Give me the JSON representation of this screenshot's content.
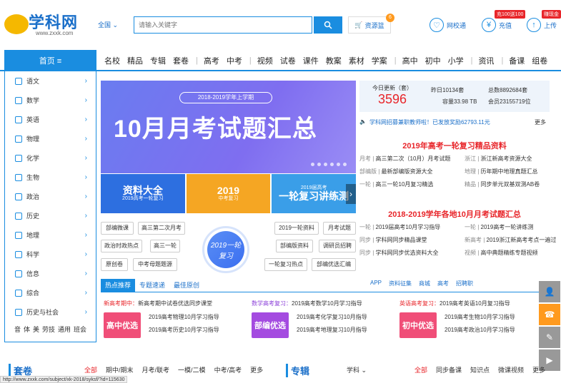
{
  "header": {
    "logo_text": "学科网",
    "logo_url": "www.zxxk.com",
    "region": "全国",
    "search_placeholder": "请输入关键字",
    "basket_label": "资源篮",
    "basket_count": "6",
    "links": [
      {
        "label": "网校通",
        "icon": "heart-icon"
      },
      {
        "label": "充值",
        "icon": "yen-icon",
        "badge": "充100送100"
      },
      {
        "label": "上传",
        "icon": "upload-icon",
        "badge": "赚现金"
      }
    ]
  },
  "nav": {
    "home": "首页 ≡",
    "groups": [
      [
        "名校",
        "精品",
        "专辑",
        "套卷"
      ],
      [
        "高考",
        "中考"
      ],
      [
        "视频",
        "试卷",
        "课件",
        "教案",
        "素材",
        "学案"
      ],
      [
        "高中",
        "初中",
        "小学"
      ],
      [
        "资讯"
      ],
      [
        "备课",
        "组卷"
      ]
    ]
  },
  "sidebar": {
    "items": [
      "语文",
      "数学",
      "英语",
      "物理",
      "化学",
      "生物",
      "政治",
      "历史",
      "地理",
      "科学",
      "信息",
      "综合",
      "历史与社会"
    ],
    "bottom": [
      "音",
      "体",
      "美",
      "劳技",
      "通用",
      "班会"
    ]
  },
  "banner": {
    "tag": "2018-2019学年上学期",
    "title": "10月月考试题汇总",
    "thumbs": [
      {
        "title": "资料大全",
        "sub": "2019高考一轮复习"
      },
      {
        "title": "2019",
        "sub": "中考复习"
      },
      {
        "title": "2019届高考",
        "sub": "一轮复习讲练测"
      }
    ]
  },
  "tags_left": [
    "部编微课",
    "高三第二次月考",
    "政治时政热点",
    "高三一轮",
    "原创卷",
    "中考母题题源"
  ],
  "tags_right": [
    "2019一轮资料",
    "月考试题",
    "部编版资料",
    "调研员招聘",
    "一轮复习热点",
    "部编优选汇编"
  ],
  "ring_label": "2019一轮复习",
  "stats": {
    "today_label": "今日更新（套）",
    "today_value": "3596",
    "yesterday": "昨日10134套",
    "total": "总数8892684套",
    "capacity": "容量33.98 TB",
    "members": "会员23155719位"
  },
  "notice": {
    "text": "学科网招募兼职教师啦！已发放奖励62793.11元",
    "more": "更多"
  },
  "section1": {
    "title": "2019年高考一轮复习精品资料",
    "rows": [
      [
        "月考",
        "高三第二次（10月）月考试题",
        "浙江",
        "浙江新高考资源大全"
      ],
      [
        "部编版",
        "最新部编版资源大全",
        "地理",
        "历年期中地理真题汇总"
      ],
      [
        "一轮",
        "高三一轮10月复习精选",
        "精品",
        "同步单元双基双测AB卷"
      ]
    ]
  },
  "section2": {
    "title": "2018-2019学年各地10月月考试题汇总",
    "rows": [
      [
        "一轮",
        "2019届高考10月学习指导",
        "一轮",
        "2019高考一轮讲练测"
      ],
      [
        "同步",
        "学科网同步精品课堂",
        "新高考",
        "2019浙江新高考考点一遍过"
      ],
      [
        "同步",
        "学科网同步优选资料大全",
        "视频",
        "高中典题精练专题视频"
      ]
    ]
  },
  "tabs": [
    "热点推荐",
    "专题速递",
    "最佳原创"
  ],
  "toolbar": [
    "APP",
    "资料征集",
    "商城",
    "高考",
    "招聘职"
  ],
  "promos": [
    {
      "head_tag": "新高考期中",
      "head": "新高考期中试卷优选同步课堂",
      "box": "高中优选",
      "items": [
        "2019高考物理10月学习指导",
        "2019高考历史10月学习指导"
      ]
    },
    {
      "head_tag": "数学高考复习",
      "head": "2019高考数学10月学习指导",
      "box": "部编优选",
      "items": [
        "2019高考化学复习10月指导",
        "2019高考地理复习10月指导"
      ]
    },
    {
      "head_tag": "英语高考复习",
      "head": "2019高考英语10月复习指导",
      "box": "初中优选",
      "items": [
        "2019高考生物10月学习指导",
        "2019高考政治10月学习指导"
      ]
    }
  ],
  "bottom": {
    "left_title": "套卷",
    "left_tabs": [
      "全部",
      "期中/期末",
      "月考/联考",
      "一模/二模",
      "中考/高考",
      "更多"
    ],
    "right_title": "专辑",
    "right_select": "学科",
    "right_tabs": [
      "全部",
      "同步备课",
      "知识点",
      "微课视频",
      "更多"
    ]
  },
  "status_url": "http://www.zxxk.com/subject/xk-2018/syksf/?id=115630",
  "colors": {
    "brand": "#1a8de0",
    "accent_red": "#e8252a",
    "orange": "#ff9a1e"
  }
}
